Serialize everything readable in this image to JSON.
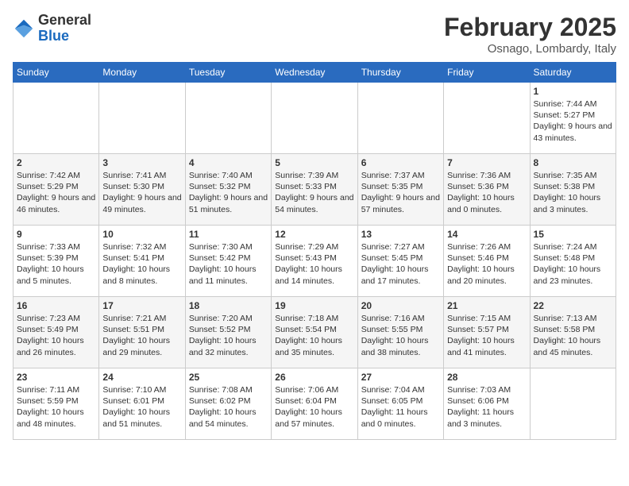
{
  "logo": {
    "general": "General",
    "blue": "Blue"
  },
  "title": "February 2025",
  "location": "Osnago, Lombardy, Italy",
  "days_of_week": [
    "Sunday",
    "Monday",
    "Tuesday",
    "Wednesday",
    "Thursday",
    "Friday",
    "Saturday"
  ],
  "weeks": [
    [
      {
        "day": "",
        "text": ""
      },
      {
        "day": "",
        "text": ""
      },
      {
        "day": "",
        "text": ""
      },
      {
        "day": "",
        "text": ""
      },
      {
        "day": "",
        "text": ""
      },
      {
        "day": "",
        "text": ""
      },
      {
        "day": "1",
        "text": "Sunrise: 7:44 AM\nSunset: 5:27 PM\nDaylight: 9 hours and 43 minutes."
      }
    ],
    [
      {
        "day": "2",
        "text": "Sunrise: 7:42 AM\nSunset: 5:29 PM\nDaylight: 9 hours and 46 minutes."
      },
      {
        "day": "3",
        "text": "Sunrise: 7:41 AM\nSunset: 5:30 PM\nDaylight: 9 hours and 49 minutes."
      },
      {
        "day": "4",
        "text": "Sunrise: 7:40 AM\nSunset: 5:32 PM\nDaylight: 9 hours and 51 minutes."
      },
      {
        "day": "5",
        "text": "Sunrise: 7:39 AM\nSunset: 5:33 PM\nDaylight: 9 hours and 54 minutes."
      },
      {
        "day": "6",
        "text": "Sunrise: 7:37 AM\nSunset: 5:35 PM\nDaylight: 9 hours and 57 minutes."
      },
      {
        "day": "7",
        "text": "Sunrise: 7:36 AM\nSunset: 5:36 PM\nDaylight: 10 hours and 0 minutes."
      },
      {
        "day": "8",
        "text": "Sunrise: 7:35 AM\nSunset: 5:38 PM\nDaylight: 10 hours and 3 minutes."
      }
    ],
    [
      {
        "day": "9",
        "text": "Sunrise: 7:33 AM\nSunset: 5:39 PM\nDaylight: 10 hours and 5 minutes."
      },
      {
        "day": "10",
        "text": "Sunrise: 7:32 AM\nSunset: 5:41 PM\nDaylight: 10 hours and 8 minutes."
      },
      {
        "day": "11",
        "text": "Sunrise: 7:30 AM\nSunset: 5:42 PM\nDaylight: 10 hours and 11 minutes."
      },
      {
        "day": "12",
        "text": "Sunrise: 7:29 AM\nSunset: 5:43 PM\nDaylight: 10 hours and 14 minutes."
      },
      {
        "day": "13",
        "text": "Sunrise: 7:27 AM\nSunset: 5:45 PM\nDaylight: 10 hours and 17 minutes."
      },
      {
        "day": "14",
        "text": "Sunrise: 7:26 AM\nSunset: 5:46 PM\nDaylight: 10 hours and 20 minutes."
      },
      {
        "day": "15",
        "text": "Sunrise: 7:24 AM\nSunset: 5:48 PM\nDaylight: 10 hours and 23 minutes."
      }
    ],
    [
      {
        "day": "16",
        "text": "Sunrise: 7:23 AM\nSunset: 5:49 PM\nDaylight: 10 hours and 26 minutes."
      },
      {
        "day": "17",
        "text": "Sunrise: 7:21 AM\nSunset: 5:51 PM\nDaylight: 10 hours and 29 minutes."
      },
      {
        "day": "18",
        "text": "Sunrise: 7:20 AM\nSunset: 5:52 PM\nDaylight: 10 hours and 32 minutes."
      },
      {
        "day": "19",
        "text": "Sunrise: 7:18 AM\nSunset: 5:54 PM\nDaylight: 10 hours and 35 minutes."
      },
      {
        "day": "20",
        "text": "Sunrise: 7:16 AM\nSunset: 5:55 PM\nDaylight: 10 hours and 38 minutes."
      },
      {
        "day": "21",
        "text": "Sunrise: 7:15 AM\nSunset: 5:57 PM\nDaylight: 10 hours and 41 minutes."
      },
      {
        "day": "22",
        "text": "Sunrise: 7:13 AM\nSunset: 5:58 PM\nDaylight: 10 hours and 45 minutes."
      }
    ],
    [
      {
        "day": "23",
        "text": "Sunrise: 7:11 AM\nSunset: 5:59 PM\nDaylight: 10 hours and 48 minutes."
      },
      {
        "day": "24",
        "text": "Sunrise: 7:10 AM\nSunset: 6:01 PM\nDaylight: 10 hours and 51 minutes."
      },
      {
        "day": "25",
        "text": "Sunrise: 7:08 AM\nSunset: 6:02 PM\nDaylight: 10 hours and 54 minutes."
      },
      {
        "day": "26",
        "text": "Sunrise: 7:06 AM\nSunset: 6:04 PM\nDaylight: 10 hours and 57 minutes."
      },
      {
        "day": "27",
        "text": "Sunrise: 7:04 AM\nSunset: 6:05 PM\nDaylight: 11 hours and 0 minutes."
      },
      {
        "day": "28",
        "text": "Sunrise: 7:03 AM\nSunset: 6:06 PM\nDaylight: 11 hours and 3 minutes."
      },
      {
        "day": "",
        "text": ""
      }
    ]
  ]
}
